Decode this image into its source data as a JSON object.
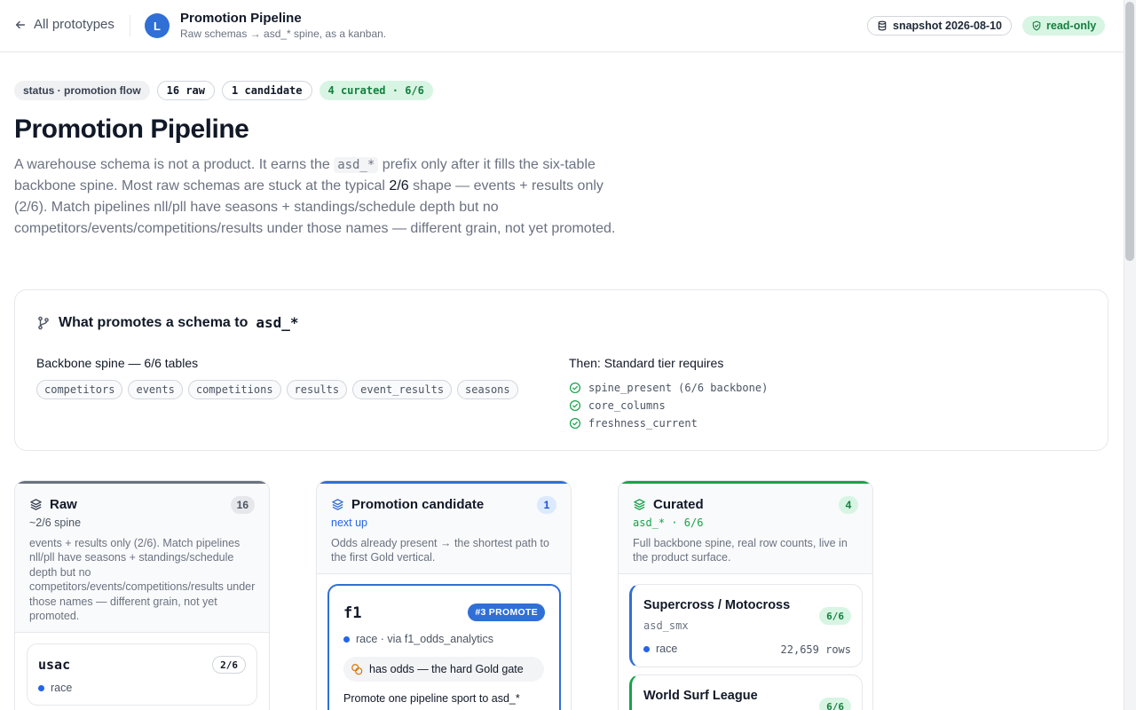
{
  "header": {
    "back_label": "All prototypes",
    "avatar_letter": "L",
    "title": "Promotion Pipeline",
    "subtitle": "Raw schemas → asd_* spine, as a kanban.",
    "snapshot": "snapshot 2026-08-10",
    "readonly": "read-only"
  },
  "chips": {
    "status": "status · promotion flow",
    "raw": "16 raw",
    "candidate": "1 candidate",
    "curated": "4 curated · 6/6"
  },
  "page": {
    "title": "Promotion Pipeline",
    "intro_1": "A warehouse schema is not a product. It earns the ",
    "intro_code": "asd_*",
    "intro_2": " prefix only after it fills the six-table backbone spine. Most raw schemas are stuck at the typical ",
    "intro_bold": "2/6",
    "intro_3": " shape — events + results only (2/6). Match pipelines nll/pll have seasons + standings/schedule depth but no competitors/events/competitions/results under those names — different grain, not yet promoted."
  },
  "rules": {
    "title": "What promotes a schema to",
    "title_code": "asd_*",
    "backbone_heading": "Backbone spine — 6/6 tables",
    "tables": [
      "competitors",
      "events",
      "competitions",
      "results",
      "event_results",
      "seasons"
    ],
    "tier_heading": "Then: Standard tier requires",
    "requirements": [
      "spine_present (6/6 backbone)",
      "core_columns",
      "freshness_current"
    ]
  },
  "columns": {
    "raw": {
      "title": "Raw",
      "count": "16",
      "sub": "~2/6 spine",
      "desc": "events + results only (2/6). Match pipelines nll/pll have seasons + standings/schedule depth but no competitors/events/competitions/results under those names — different grain, not yet promoted.",
      "cards": [
        {
          "name": "usac",
          "badge": "2/6",
          "kind": "race"
        }
      ]
    },
    "candidate": {
      "title": "Promotion candidate",
      "count": "1",
      "sub": "next up",
      "desc": "Odds already present → the shortest path to the first Gold vertical.",
      "cards": [
        {
          "name": "f1",
          "badge": "#3 PROMOTE",
          "kind": "race · via f1_odds_analytics",
          "gate": "has odds — the hard Gold gate",
          "note": "Promote one pipeline sport to asd_*"
        }
      ]
    },
    "curated": {
      "title": "Curated",
      "count": "4",
      "sub": "asd_* · 6/6",
      "desc": "Full backbone spine, real row counts, live in the product surface.",
      "cards": [
        {
          "name": "Supercross / Motocross",
          "schema": "asd_smx",
          "badge": "6/6",
          "kind": "race",
          "rows": "22,659 rows"
        },
        {
          "name": "World Surf League",
          "badge": "6/6"
        }
      ]
    }
  },
  "colors": {
    "accent_blue": "#2f6fd6",
    "raw_bar": "#6b7280",
    "curated_green": "#16a34a"
  }
}
